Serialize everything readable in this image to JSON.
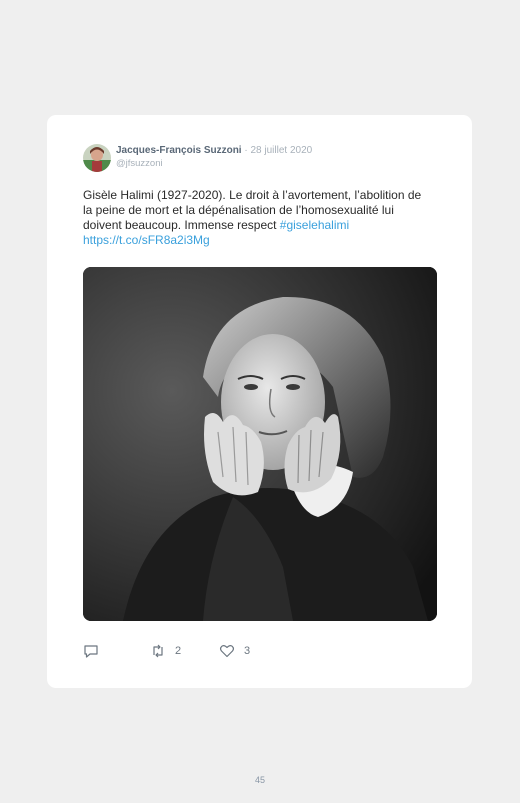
{
  "tweet": {
    "author_name": "Jacques-François Suzzoni",
    "date": "28 juillet 2020",
    "handle": "@jfsuzzoni",
    "text": "Gisèle Halimi (1927-2020). Le droit à l’avortement, l’abolition de la peine de mort et la dépénalisation de l’homosexualité lui doivent beaucoup. Immense respect",
    "hashtag": "#giselehalimi",
    "link": "https://t.co/sFR8a2i3Mg",
    "photo_icon": "portrait-photo",
    "actions": {
      "reply_icon": "reply-icon",
      "retweet_icon": "retweet-icon",
      "retweet_count": "2",
      "like_icon": "heart-icon",
      "like_count": "3"
    }
  },
  "page": {
    "number": "45"
  },
  "colors": {
    "background": "#efefef",
    "card": "#ffffff",
    "link": "#3aa0dc",
    "name": "#5a6877",
    "muted": "#a8b1ba"
  }
}
